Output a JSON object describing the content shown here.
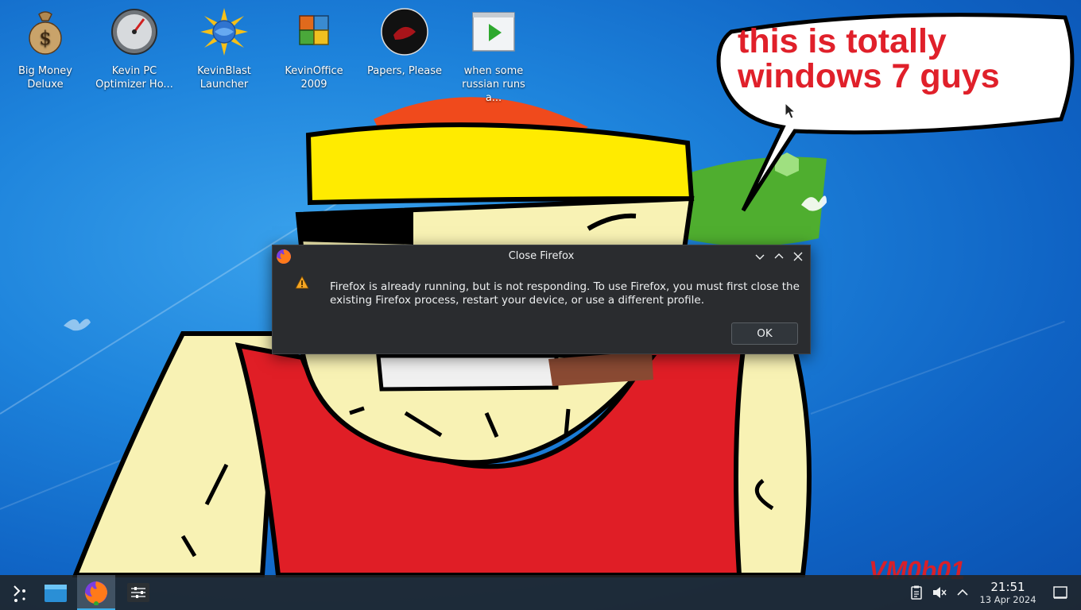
{
  "desktop": {
    "icons": [
      {
        "label": "Big Money Deluxe"
      },
      {
        "label": "Kevin PC Optimizer Ho..."
      },
      {
        "label": "KevinBlast Launcher"
      },
      {
        "label": "KevinOffice 2009"
      },
      {
        "label": "Papers, Please"
      },
      {
        "label": "when some russian runs a..."
      }
    ],
    "bubble_text": "this is totally windows 7 guys",
    "watermark": "VM0b01"
  },
  "dialog": {
    "title": "Close Firefox",
    "message": "Firefox is already running, but is not responding. To use Firefox, you must first close the existing Firefox process, restart your device, or use a different profile.",
    "ok_label": "OK"
  },
  "taskbar": {
    "clock_time": "21:51",
    "clock_date": "13 Apr 2024"
  },
  "colors": {
    "accent": "#3daee9",
    "bubble_text": "#e0202a",
    "dialog_bg": "#2a2c2f"
  }
}
